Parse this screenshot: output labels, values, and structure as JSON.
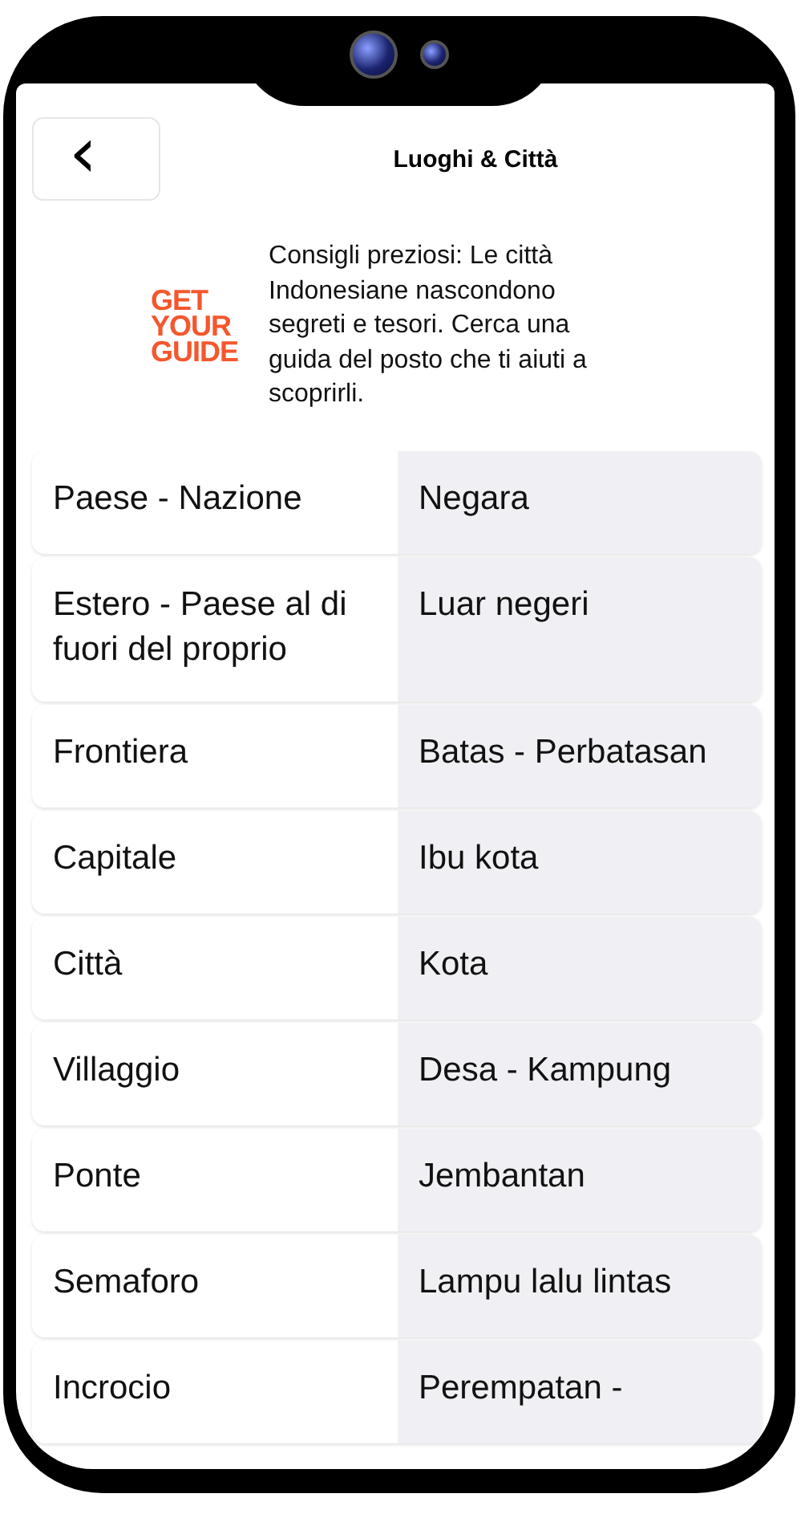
{
  "header": {
    "back_icon": "‹",
    "title": "Luoghi & Città"
  },
  "tip": {
    "logo": [
      "GET",
      "YOUR",
      "GUIDE"
    ],
    "text": "Consigli preziosi: Le città Indonesiane nascondono segreti e tesori. Cerca una guida del posto che ti aiuti a scoprirli."
  },
  "rows": [
    {
      "italian": "Paese - Nazione",
      "indonesian": "Negara"
    },
    {
      "italian": "Estero - Paese al di fuori del proprio",
      "indonesian": "Luar negeri"
    },
    {
      "italian": "Frontiera",
      "indonesian": "Batas - Perbatasan"
    },
    {
      "italian": "Capitale",
      "indonesian": "Ibu kota"
    },
    {
      "italian": "Città",
      "indonesian": "Kota"
    },
    {
      "italian": "Villaggio",
      "indonesian": "Desa - Kampung"
    },
    {
      "italian": "Ponte",
      "indonesian": "Jembantan"
    },
    {
      "italian": "Semaforo",
      "indonesian": "Lampu lalu lintas"
    },
    {
      "italian": "Incrocio",
      "indonesian": "Perempatan -"
    }
  ]
}
